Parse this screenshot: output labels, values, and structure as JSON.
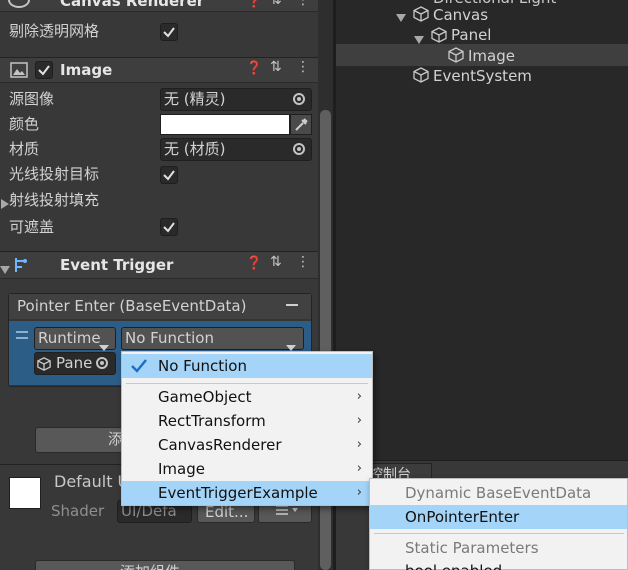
{
  "inspector": {
    "canvas_renderer": {
      "title": "Canvas Renderer",
      "cull_label": "剔除透明网格",
      "cull_checked": true
    },
    "image": {
      "title": "Image",
      "enabled": true,
      "source_image_label": "源图像",
      "source_image_value": "无 (精灵)",
      "color_label": "颜色",
      "color_value": "#ffffff",
      "material_label": "材质",
      "material_value": "无 (材质)",
      "raycast_target_label": "光线投射目标",
      "raycast_target_checked": true,
      "raycast_padding_label": "射线投射填充",
      "maskable_label": "可遮盖",
      "maskable_checked": true
    },
    "event_trigger": {
      "title": "Event Trigger",
      "entry_title": "Pointer Enter (BaseEventData)",
      "runtime_value": "Runtime",
      "function_value": "No Function",
      "object_value": "Pane",
      "add_button_label": "添"
    },
    "material": {
      "name": "Default U",
      "shader_label": "Shader",
      "shader_value": "UI/Defa",
      "edit_label": "Edit..."
    },
    "bottom_button_label": "添加组件"
  },
  "hierarchy": {
    "top_item": "Directional Light",
    "items": [
      {
        "label": "Canvas"
      },
      {
        "label": "Panel"
      },
      {
        "label": "Image"
      },
      {
        "label": "EventSystem"
      }
    ]
  },
  "lower_panel": {
    "tab_label": "控制台"
  },
  "context_menu": {
    "items": [
      {
        "label": "No Function",
        "checked": true,
        "has_submenu": false
      },
      {
        "label": "GameObject",
        "has_submenu": true
      },
      {
        "label": "RectTransform",
        "has_submenu": true
      },
      {
        "label": "CanvasRenderer",
        "has_submenu": true
      },
      {
        "label": "Image",
        "has_submenu": true
      },
      {
        "label": "EventTriggerExample",
        "has_submenu": true
      }
    ]
  },
  "submenu": {
    "dynamic_header": "Dynamic BaseEventData",
    "highlighted_item": "OnPointerEnter",
    "static_header": "Static Parameters",
    "next_item": "bool enabled"
  },
  "colors": {
    "selection_blue": "#a4d4f7",
    "event_row_blue": "#2c5d87",
    "panel_bg": "#383838"
  }
}
